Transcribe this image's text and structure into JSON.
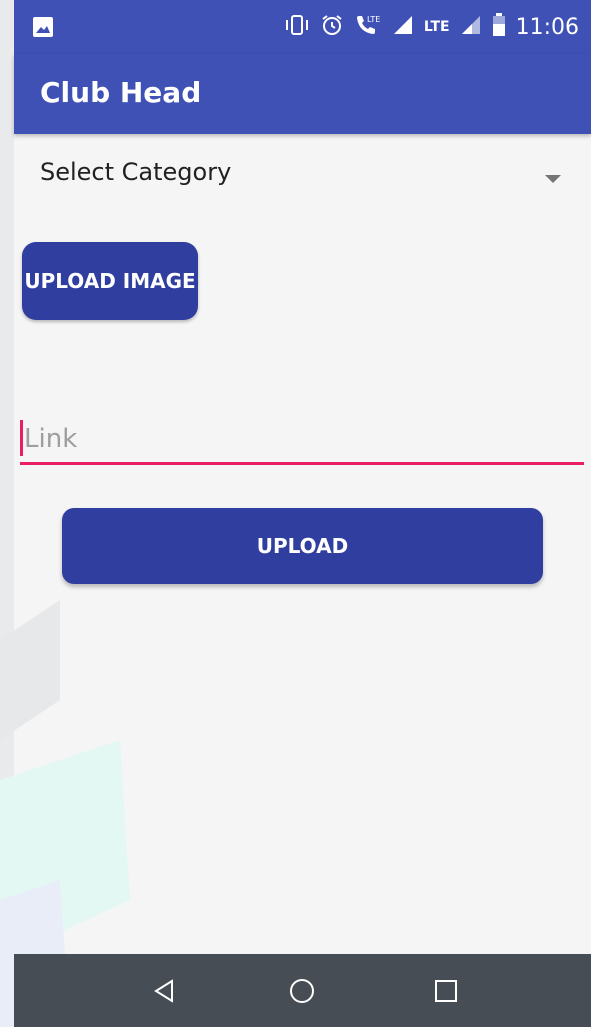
{
  "status_bar": {
    "time": "11:06",
    "icons": [
      "image-icon",
      "vibrate-icon",
      "alarm-icon",
      "lte-call-icon",
      "signal-icon",
      "lte-label",
      "signal-icon",
      "battery-icon"
    ],
    "lte_label": "LTE"
  },
  "app_bar": {
    "title": "Club Head",
    "color": "#3f51b5"
  },
  "form": {
    "category_spinner": {
      "selected": "Select Category"
    },
    "upload_image_label": "UPLOAD IMAGE",
    "link_field": {
      "value": "",
      "placeholder": "Link"
    },
    "upload_label": "UPLOAD"
  },
  "nav_bar": {
    "buttons": [
      "back-icon",
      "home-icon",
      "recents-icon"
    ]
  },
  "colors": {
    "primary": "#3f51b5",
    "button": "#303f9f",
    "accent": "#e91e63"
  }
}
